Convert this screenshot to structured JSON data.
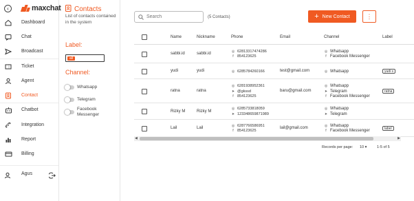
{
  "app": {
    "brand": "maxchat",
    "brand_color": "#f05a22"
  },
  "sidebar": {
    "collapse_icon": "chevron-left-icon",
    "items": [
      {
        "label": "Dashboard",
        "icon": "home-icon"
      },
      {
        "label": "Chat",
        "icon": "chat-icon"
      },
      {
        "label": "Broadcast",
        "icon": "send-icon"
      },
      {
        "label": "Ticket",
        "icon": "ticket-icon"
      },
      {
        "label": "Agent",
        "icon": "agent-icon"
      },
      {
        "label": "Contact",
        "icon": "contact-icon",
        "active": true
      },
      {
        "label": "Chatbot",
        "icon": "chatbot-icon"
      },
      {
        "label": "Integration",
        "icon": "link-icon"
      },
      {
        "label": "Report",
        "icon": "report-icon"
      },
      {
        "label": "Billing",
        "icon": "billing-icon"
      }
    ],
    "user": {
      "name": "Agus",
      "logout_icon": "logout-icon"
    }
  },
  "filter_panel": {
    "title": "Contacts",
    "description": "List of contacts contained in the system",
    "label_heading": "Label:",
    "label_chip": "all",
    "channel_heading": "Channel:",
    "channels": [
      "Whatsapp",
      "Telegram",
      "Facebook Messenger"
    ]
  },
  "toolbar": {
    "search_placeholder": "Search",
    "count_text": "(5 Contacts)",
    "new_contact_label": "New Contact",
    "more_label": "⋮"
  },
  "table": {
    "headers": [
      "Name",
      "Nickname",
      "Phone",
      "Email",
      "Channel",
      "Label"
    ],
    "rows": [
      {
        "name": "sabbi.id",
        "nickname": "sabbi.id",
        "phones": [
          [
            "whatsapp",
            "6281331747428​6"
          ],
          [
            "facebook",
            "854123625"
          ]
        ],
        "email": "",
        "channels": [
          [
            "whatsapp",
            "Whatsapp"
          ],
          [
            "facebook",
            "Facebook Messenger"
          ]
        ],
        "label": ""
      },
      {
        "name": "yudi",
        "nickname": "yudi",
        "phones": [
          [
            "whatsapp",
            "6285784260166"
          ]
        ],
        "email": "test@gmail.com",
        "channels": [
          [
            "whatsapp",
            "Whatsapp"
          ]
        ],
        "label": "yudi s"
      },
      {
        "name": "ratna",
        "nickname": "ratna",
        "phones": [
          [
            "whatsapp",
            "6281938952361"
          ],
          [
            "telegram",
            "@gkssd"
          ],
          [
            "facebook",
            "854123625"
          ]
        ],
        "email": "baru@gmail.com",
        "channels": [
          [
            "whatsapp",
            "Whatsapp"
          ],
          [
            "telegram",
            "Telegram"
          ],
          [
            "facebook",
            "Facebook Messenger"
          ]
        ],
        "label": "ratna"
      },
      {
        "name": "Rizky M",
        "nickname": "Rizky M",
        "phones": [
          [
            "whatsapp",
            "6285733818059"
          ],
          [
            "telegram",
            "123348659871989"
          ]
        ],
        "email": "",
        "channels": [
          [
            "whatsapp",
            "Whatsapp"
          ],
          [
            "telegram",
            "Telegram"
          ]
        ],
        "label": ""
      },
      {
        "name": "Lail",
        "nickname": "Lail",
        "phones": [
          [
            "whatsapp",
            "6287766586951"
          ],
          [
            "facebook",
            "854123625"
          ]
        ],
        "email": "lail@gmail.com",
        "channels": [
          [
            "whatsapp",
            "Whatsapp"
          ],
          [
            "facebook",
            "Facebook Messenger"
          ]
        ],
        "label": "label"
      }
    ]
  },
  "pagination": {
    "records_label": "Records per page:",
    "per_page": "10",
    "range": "1-5 of 5"
  }
}
